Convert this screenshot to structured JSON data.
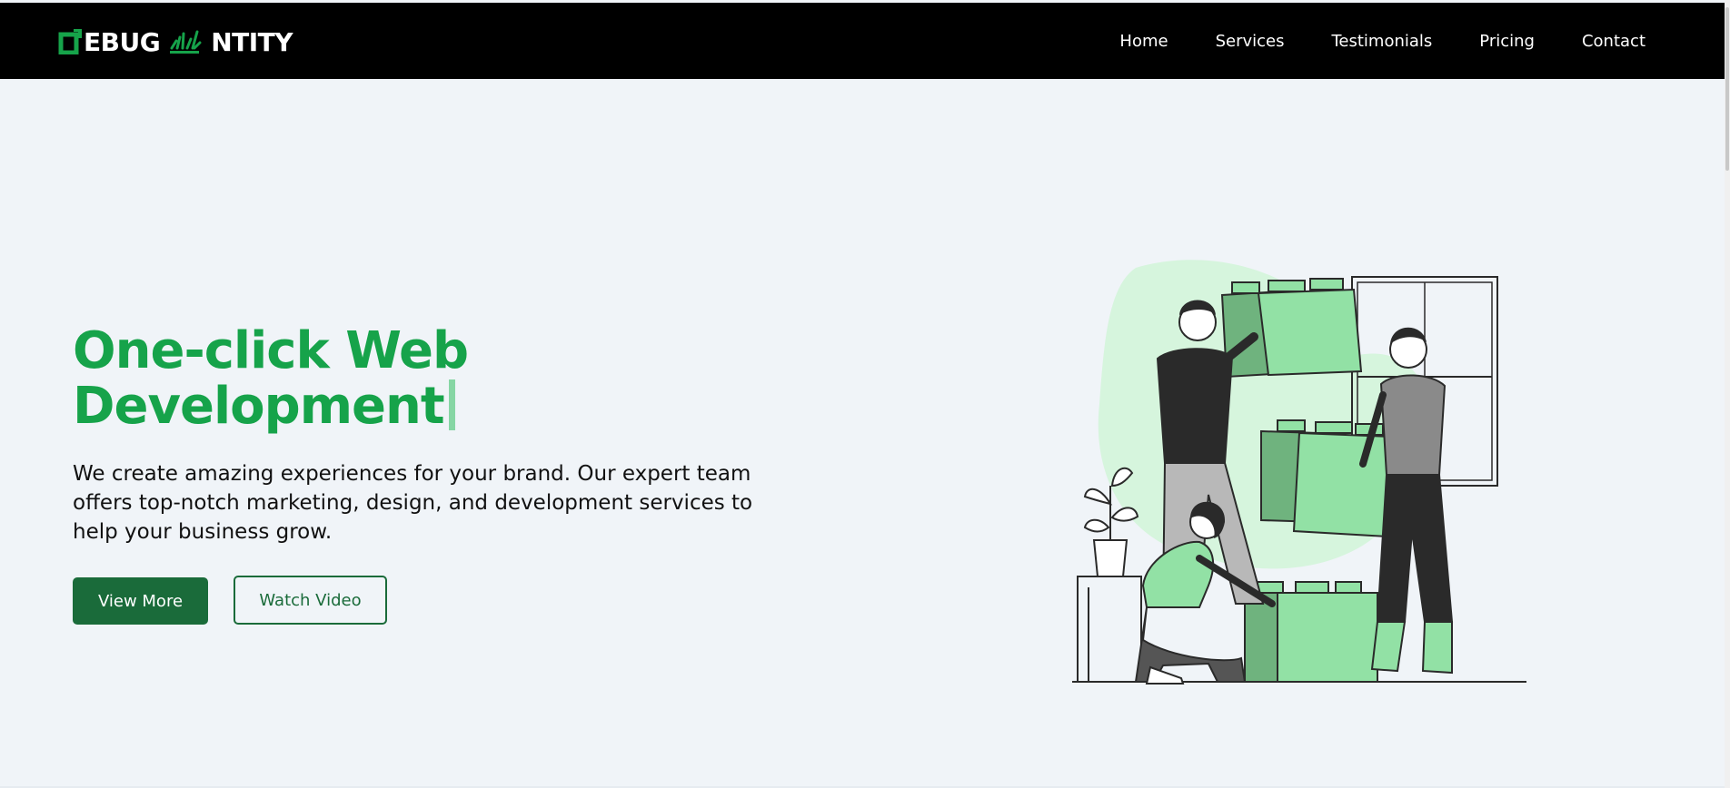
{
  "nav": {
    "logo": {
      "part1": "EBUG",
      "part2": "NTITY"
    },
    "links": [
      "Home",
      "Services",
      "Testimonials",
      "Pricing",
      "Contact"
    ]
  },
  "hero": {
    "title_line1": "One-click Web",
    "title_line2": "Development",
    "description": "We create amazing experiences for your brand. Our expert team offers top-notch marketing, design, and development services to help your business grow.",
    "primary_button": "View More",
    "secondary_button": "Watch Video"
  },
  "colors": {
    "brand_green": "#16a34a",
    "dark_green": "#1a6b3a",
    "light_green": "#92e1a5",
    "nav_bg": "#000000",
    "page_bg": "#f0f4f8"
  },
  "icons": {
    "logo_d": "logo-d-icon",
    "logo_i": "logo-i-grass-icon"
  }
}
